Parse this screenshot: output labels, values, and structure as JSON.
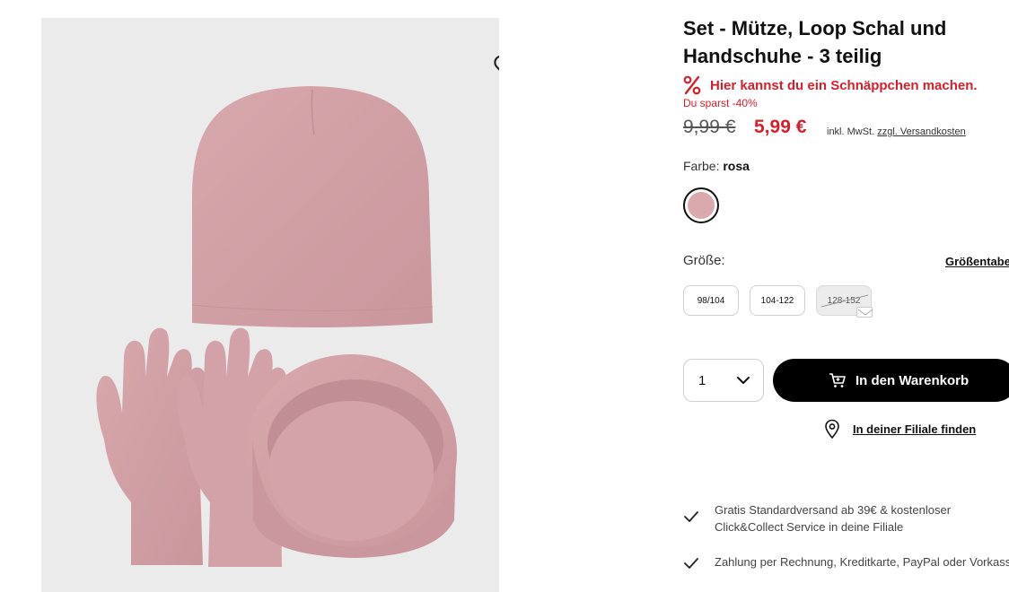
{
  "product": {
    "title_line1": "Set - Mütze, Loop Schal und",
    "title_line2": "Handschuhe - 3 teilig"
  },
  "deal": {
    "icon": "percent-icon",
    "text": "Hier kannst du ein Schnäppchen machen.",
    "savings": "Du sparst -40%"
  },
  "price": {
    "old": "9,99 €",
    "new": "5,99 €",
    "tax_prefix": "inkl. MwSt.",
    "shipping_link": "zzgl. Versandkosten"
  },
  "color": {
    "label": "Farbe:",
    "value": "rosa",
    "swatch_color": "#d9a9ad"
  },
  "size": {
    "label": "Größe:",
    "table_link": "Größentabe",
    "options": [
      "98/104",
      "104-122",
      "128-152"
    ]
  },
  "cart": {
    "quantity": "1",
    "button_label": "In den Warenkorb"
  },
  "store": {
    "link_label": "In deiner Filiale finden"
  },
  "benefits": [
    {
      "line1": "Gratis Standardversand ab 39€ & kostenloser",
      "line2": "Click&Collect Service in deine Filiale"
    },
    {
      "line1": "Zahlung per Rechnung, Kreditkarte, PayPal oder Vorkasse"
    }
  ],
  "colors": {
    "accent_red": "#d4202a",
    "primary_black": "#000000",
    "image_bg": "#ebebeb"
  }
}
